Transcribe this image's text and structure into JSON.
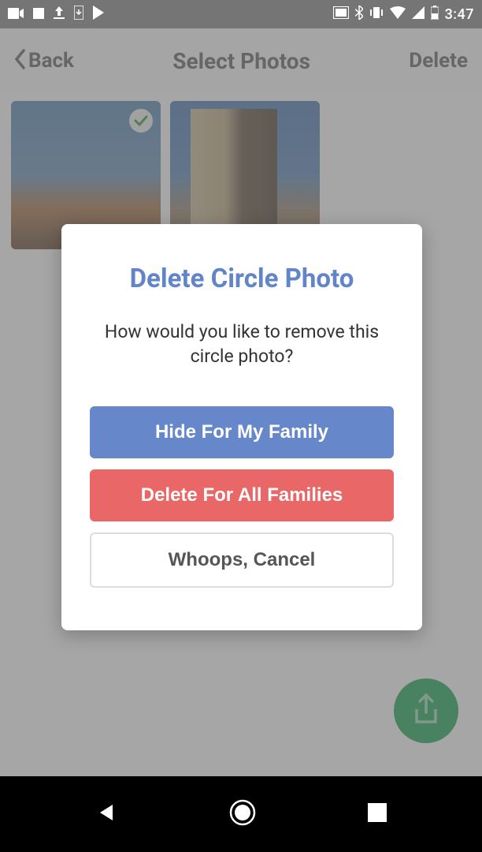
{
  "status": {
    "time": "3:47"
  },
  "header": {
    "back": "Back",
    "title": "Select Photos",
    "delete": "Delete"
  },
  "modal": {
    "title": "Delete Circle Photo",
    "message": "How would you like to remove this circle photo?",
    "hide_btn": "Hide For My Family",
    "delete_btn": "Delete For All Families",
    "cancel_btn": "Whoops, Cancel"
  },
  "photos": {
    "count": 2,
    "selected_index": 0
  },
  "colors": {
    "primary": "#6787cb",
    "danger": "#ea6767",
    "fab": "#26a65b"
  }
}
